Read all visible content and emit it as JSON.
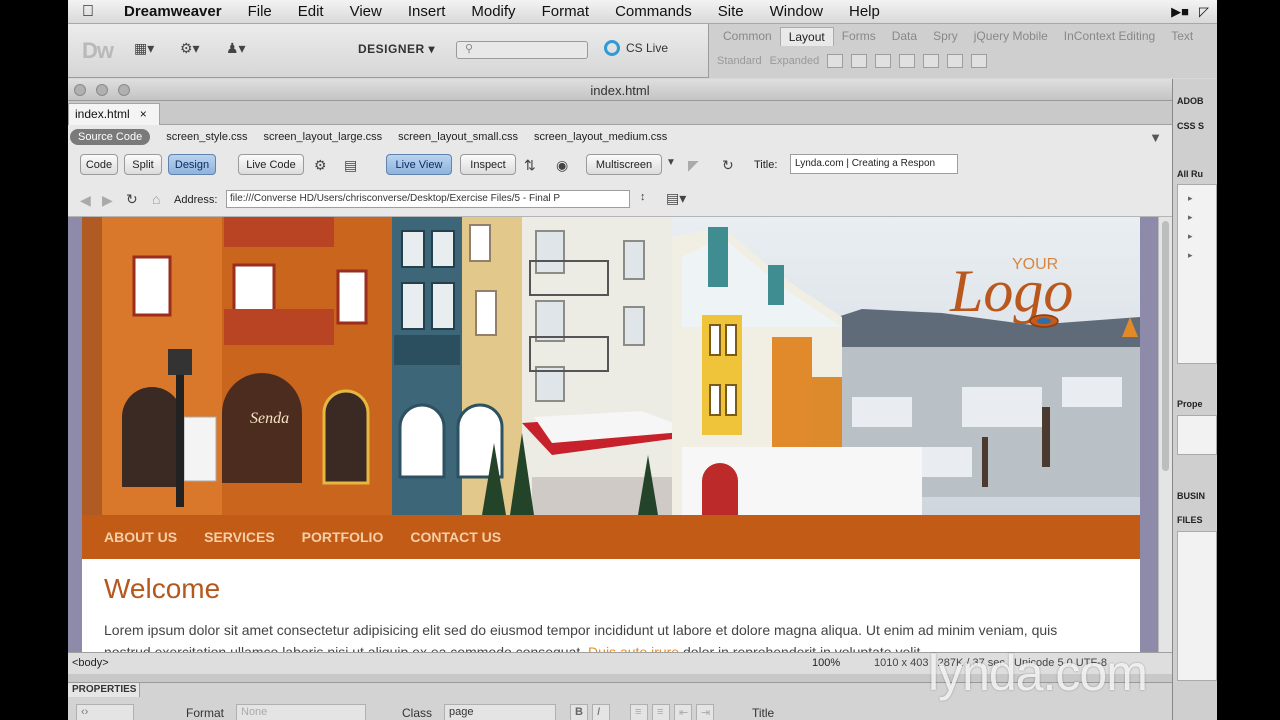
{
  "menubar": {
    "app": "Dreamweaver",
    "items": [
      "File",
      "Edit",
      "View",
      "Insert",
      "Modify",
      "Format",
      "Commands",
      "Site",
      "Window",
      "Help"
    ]
  },
  "appbar": {
    "logo": "Dw",
    "workspace": "DESIGNER ▾",
    "cslive": "CS Live"
  },
  "insert_panel": {
    "tabs": [
      "Common",
      "Layout",
      "Forms",
      "Data",
      "Spry",
      "jQuery Mobile",
      "InContext Editing",
      "Text"
    ],
    "active_tab": "Layout",
    "standard": "Standard",
    "expanded": "Expanded"
  },
  "document": {
    "window_title": "index.html",
    "tab_label": "index.html",
    "tab_close": "×",
    "source_code": "Source Code",
    "related_files": [
      "screen_style.css",
      "screen_layout_large.css",
      "screen_layout_small.css",
      "screen_layout_medium.css"
    ],
    "toolbar": {
      "code": "Code",
      "split": "Split",
      "design": "Design",
      "live_code": "Live Code",
      "live_view": "Live View",
      "inspect": "Inspect",
      "multiscreen": "Multiscreen",
      "title_label": "Title:",
      "title_value": "Lynda.com | Creating a Respon"
    },
    "address_label": "Address:",
    "address_value": "file:///Converse HD/Users/chrisconverse/Desktop/Exercise Files/5 - Final P"
  },
  "site": {
    "logo_small": "YOUR",
    "logo_big": "Logo",
    "nav": [
      "ABOUT US",
      "SERVICES",
      "PORTFOLIO",
      "CONTACT US"
    ],
    "heading": "Welcome",
    "lorem": "Lorem ipsum dolor sit amet consectetur adipisicing elit sed do eiusmod tempor incididunt ut labore et dolore magna aliqua. Ut enim ad minim veniam, quis nostrud exercitation ullamco laboris nisi ut aliquip ex ea commodo consequat.",
    "lorem_link": "Duis aute irure",
    "lorem_end": "dolor in reprehenderit in voluptate velit"
  },
  "status": {
    "tag": "<body>",
    "zoom": "100%",
    "dims": "1010 x 403   287K / 37 sec   Unicode 5.0 UTF-8"
  },
  "properties": {
    "tab": "PROPERTIES",
    "format_label": "Format",
    "format_value": "None",
    "class_label": "Class",
    "class_value": "page",
    "title_label": "Title"
  },
  "right_panel": {
    "adobe": "ADOB",
    "css": "CSS S",
    "all_rules": "All Ru",
    "properties": "Prope",
    "business": "BUSIN",
    "files": "FILES"
  },
  "watermark": "lynda.com",
  "colors": {
    "nav_bg": "#c25b16",
    "heading": "#b4581d",
    "link": "#e58a22",
    "design_bg": "#8e8aa9",
    "active_button": "#8fb3dd"
  }
}
